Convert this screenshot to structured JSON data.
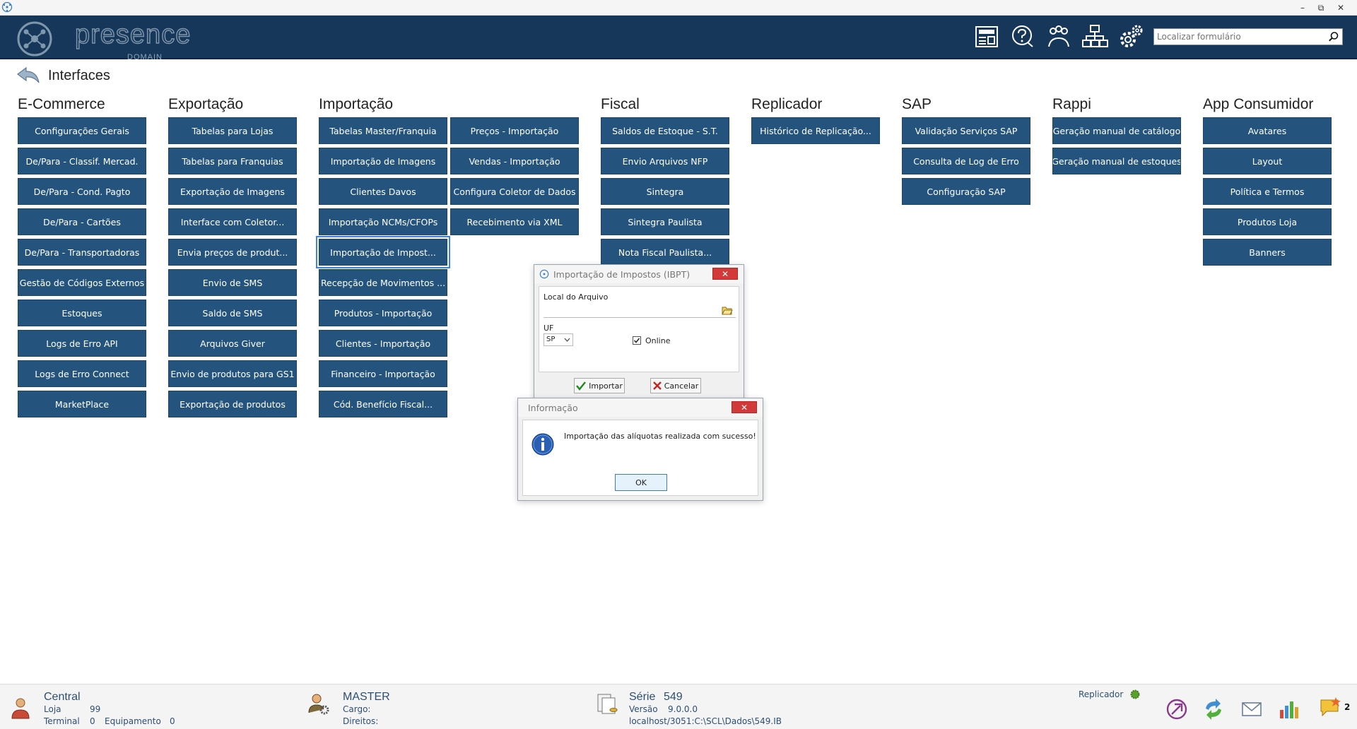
{
  "window": {
    "minimize": "–",
    "restore": "⧉",
    "close": "✕"
  },
  "header": {
    "brand": "presence",
    "brand_sub": "DOMAIN",
    "search_placeholder": "Localizar formulário",
    "icons": [
      "news-icon",
      "help-icon",
      "users-icon",
      "network-icon",
      "settings-icon"
    ]
  },
  "page": {
    "title": "Interfaces"
  },
  "columns": [
    {
      "title": "E-Commerce",
      "items": [
        "Configurações Gerais",
        "De/Para - Classif. Mercad.",
        "De/Para - Cond. Pagto",
        "De/Para - Cartões",
        "De/Para - Transportadoras",
        "Gestão de Códigos Externos",
        "Estoques",
        "Logs de Erro API",
        "Logs de Erro Connect",
        "MarketPlace"
      ]
    },
    {
      "title": "Exportação",
      "items": [
        "Tabelas para Lojas",
        "Tabelas para Franquias",
        "Exportação de Imagens",
        "Interface com Coletor...",
        "Envia preços de produt...",
        "Envio de SMS",
        "Saldo de SMS",
        "Arquivos Giver",
        "Envio de produtos para GS1",
        "Exportação de produtos"
      ]
    },
    {
      "title": "Importação",
      "items": [
        "Tabelas Master/Franquia",
        "Importação de Imagens",
        "Clientes Davos",
        "Importação NCMs/CFOPs",
        "Importação de Impost...",
        "Recepção de Movimentos ...",
        "Produtos - Importação",
        "Clientes - Importação",
        "Financeiro - Importação",
        "Cód. Benefício Fiscal..."
      ]
    },
    {
      "title": "",
      "items": [
        "Preços - Importação",
        "Vendas - Importação",
        "Configura Coletor de Dados",
        "Recebimento via XML"
      ]
    },
    {
      "title": "Fiscal",
      "items": [
        "Saldos de Estoque - S.T.",
        "Envio Arquivos NFP",
        "Sintegra",
        "Sintegra Paulista",
        "Nota Fiscal Paulista..."
      ]
    },
    {
      "title": "Replicador",
      "items": [
        "Histórico de Replicação..."
      ]
    },
    {
      "title": "SAP",
      "items": [
        "Validação Serviços SAP",
        "Consulta de Log de Erro",
        "Configuração SAP"
      ]
    },
    {
      "title": "Rappi",
      "items": [
        "Geração manual de catálogo",
        "Geração manual de estoques"
      ]
    },
    {
      "title": "App Consumidor",
      "items": [
        "Avatares",
        "Layout",
        "Política e Termos",
        "Produtos Loja",
        "Banners"
      ]
    }
  ],
  "ibpt_dialog": {
    "title": "Importação de Impostos (IBPT)",
    "close": "✕",
    "file_label": "Local do Arquivo",
    "file_value": "",
    "uf_label": "UF",
    "uf_value": "SP",
    "online_label": "Online",
    "online_checked": true,
    "import_button": "Importar",
    "cancel_button": "Cancelar"
  },
  "info_dialog": {
    "title": "Informação",
    "close": "✕",
    "message": "Importação das alíquotas realizada com sucesso!",
    "ok_button": "OK"
  },
  "statusbar": {
    "store_name": "Central",
    "loja_label": "Loja",
    "loja_value": "99",
    "terminal_label": "Terminal",
    "terminal_value": "0",
    "equip_label": "Equipamento",
    "equip_value": "0",
    "user_name": "MASTER",
    "cargo_label": "Cargo:",
    "direitos_label": "Direitos:",
    "serie_label": "Série",
    "serie_value": "549",
    "versao_label": "Versão",
    "versao_value": "9.0.0.0",
    "db_path": "localhost/3051:C:\\SCL\\Dados\\549.IB",
    "replicador_label": "Replicador",
    "replicador_color": "#5aa02c",
    "message_count": "2"
  },
  "colors": {
    "header": "#16375a",
    "tile": "#24547e",
    "close": "#d23a3a"
  }
}
